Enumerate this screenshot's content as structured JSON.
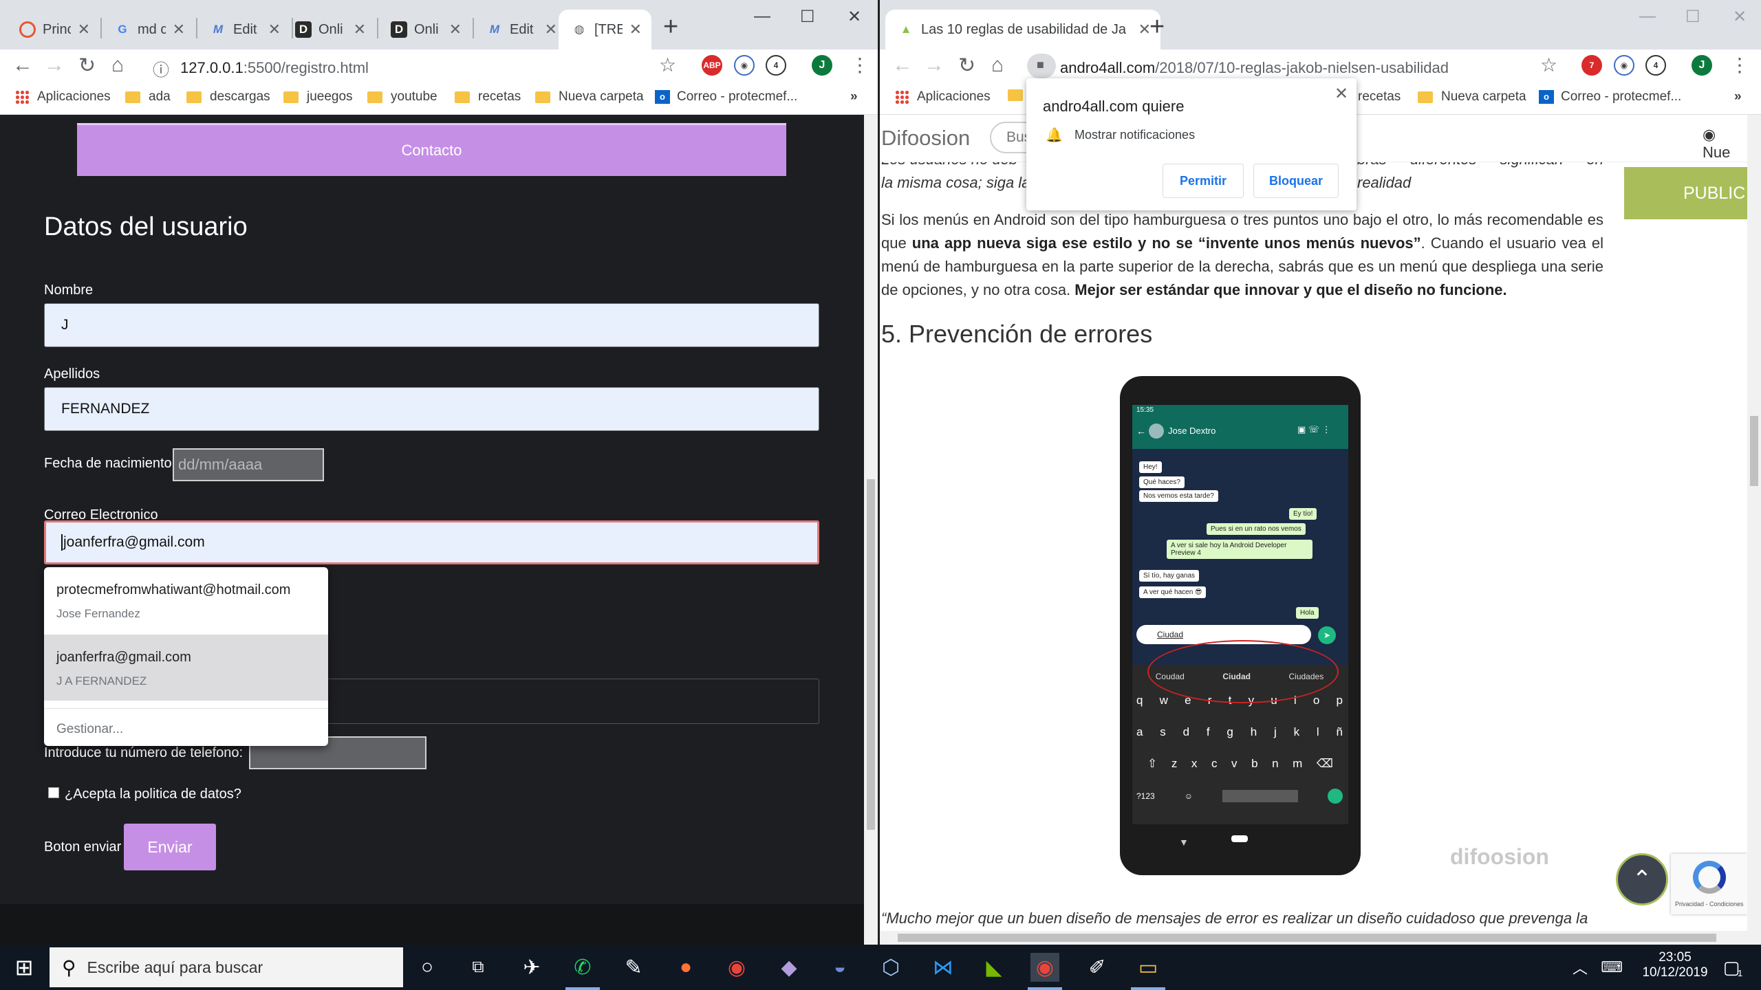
{
  "left_window": {
    "tabs": [
      {
        "title": "Princ",
        "icon": "opera-icon"
      },
      {
        "title": "md c",
        "icon": "google-icon"
      },
      {
        "title": "Edit",
        "icon": "medium-icon"
      },
      {
        "title": "Onli",
        "icon": "d-icon"
      },
      {
        "title": "Onli",
        "icon": "d-icon"
      },
      {
        "title": "Edit",
        "icon": "medium-icon"
      },
      {
        "title": "[TRE",
        "icon": "globe-icon"
      }
    ],
    "url": {
      "host": "127.0.0.1",
      "path": ":5500/registro.html"
    },
    "ext_badge": "4",
    "profile": "J",
    "bookmarks": [
      "Aplicaciones",
      "ada",
      "descargas",
      "jueegos",
      "youtube",
      "recetas",
      "Nueva carpeta",
      "Correo - protecmef..."
    ],
    "page": {
      "contact_button": "Contacto",
      "section_title": "Datos del usuario",
      "name_label": "Nombre",
      "name_value": "J",
      "surname_label": "Apellidos",
      "surname_value": "FERNANDEZ",
      "birth_label": "Fecha de nacimiento",
      "birth_placeholder": "dd/mm/aaaa",
      "email_label": "Correo Electronico",
      "email_value": "joanferfra@gmail.com",
      "autofill": [
        {
          "email": "protecmefromwhatiwant@hotmail.com",
          "name": "Jose Fernandez"
        },
        {
          "email": "joanferfra@gmail.com",
          "name": "J A FERNANDEZ"
        }
      ],
      "autofill_manage": "Gestionar...",
      "phone_label": "Introduce tu número de telefono:",
      "policy_label": "¿Acepta la politica de datos?",
      "send_label": "Boton enviar",
      "send_button": "Enviar"
    }
  },
  "right_window": {
    "tab_title": "Las 10 reglas de usabilidad de Ja",
    "url": {
      "host": "andro4all.com",
      "path": "/2018/07/10-reglas-jakob-nielsen-usabilidad"
    },
    "ext_badges": [
      "7",
      "4"
    ],
    "profile": "J",
    "bookmarks": [
      "Aplicaciones",
      "recetas",
      "Nueva carpeta",
      "Correo - protecmef..."
    ],
    "notification": {
      "title": "andro4all.com quiere",
      "message": "Mostrar notificaciones",
      "allow": "Permitir",
      "block": "Bloquear"
    },
    "site": {
      "logo": "Difoosion",
      "search": "Bus",
      "nav_right": "Nue",
      "ad": "PUBLIC",
      "quote_top1": "Los usuarios no deb",
      "quote_top1b": "bras diferentes significan en realidad",
      "quote_top2": "la misma cosa; siga la",
      "para_a": "Si los menús en Android son del tipo hamburguesa o tres puntos uno bajo el otro, lo más recomendable es que ",
      "para_b": "una app nueva siga ese estilo y no se “invente unos menús nuevos”",
      "para_c": ". Cuando el usuario vea el menú de hamburguesa en la parte superior de la derecha, sabrás que es un menú que despliega una serie de opciones, y no otra cosa. ",
      "para_d": "Mejor ser estándar que innovar y que el diseño no funcione.",
      "heading": "5. Prevención de errores",
      "watermark": "difoosion",
      "bottom_quote": "“Mucho mejor que un buen diseño de mensajes de error es realizar un diseño cuidadoso que prevenga la",
      "recaptcha": "Privacidad - Condiciones"
    },
    "phone": {
      "time": "15:35",
      "contact": "Jose Dextro",
      "messages": [
        {
          "text": "Hey!",
          "side": "in"
        },
        {
          "text": "Qué haces?",
          "side": "in"
        },
        {
          "text": "Nos vemos esta tarde?",
          "side": "in"
        },
        {
          "text": "Ey tío!",
          "side": "out"
        },
        {
          "text": "Pues si en un rato nos vemos",
          "side": "out"
        },
        {
          "text": "A ver si sale hoy la Android Developer Preview 4",
          "side": "out"
        },
        {
          "text": "Sí tío, hay ganas",
          "side": "in"
        },
        {
          "text": "A ver qué hacen 😎",
          "side": "in"
        },
        {
          "text": "Hola",
          "side": "out"
        }
      ],
      "input": "Ciudad",
      "suggestions": [
        "Coudad",
        "Ciudad",
        "Ciudades"
      ],
      "keys_row1": [
        "q",
        "w",
        "e",
        "r",
        "t",
        "y",
        "u",
        "i",
        "o",
        "p"
      ],
      "keys_row2": [
        "a",
        "s",
        "d",
        "f",
        "g",
        "h",
        "j",
        "k",
        "l",
        "ñ"
      ],
      "keys_row3": [
        "z",
        "x",
        "c",
        "v",
        "b",
        "n",
        "m"
      ],
      "key_sym": "?123"
    }
  },
  "taskbar": {
    "search_placeholder": "Escribe aquí para buscar",
    "time": "23:05",
    "date": "10/12/2019",
    "notif_count": "1"
  }
}
